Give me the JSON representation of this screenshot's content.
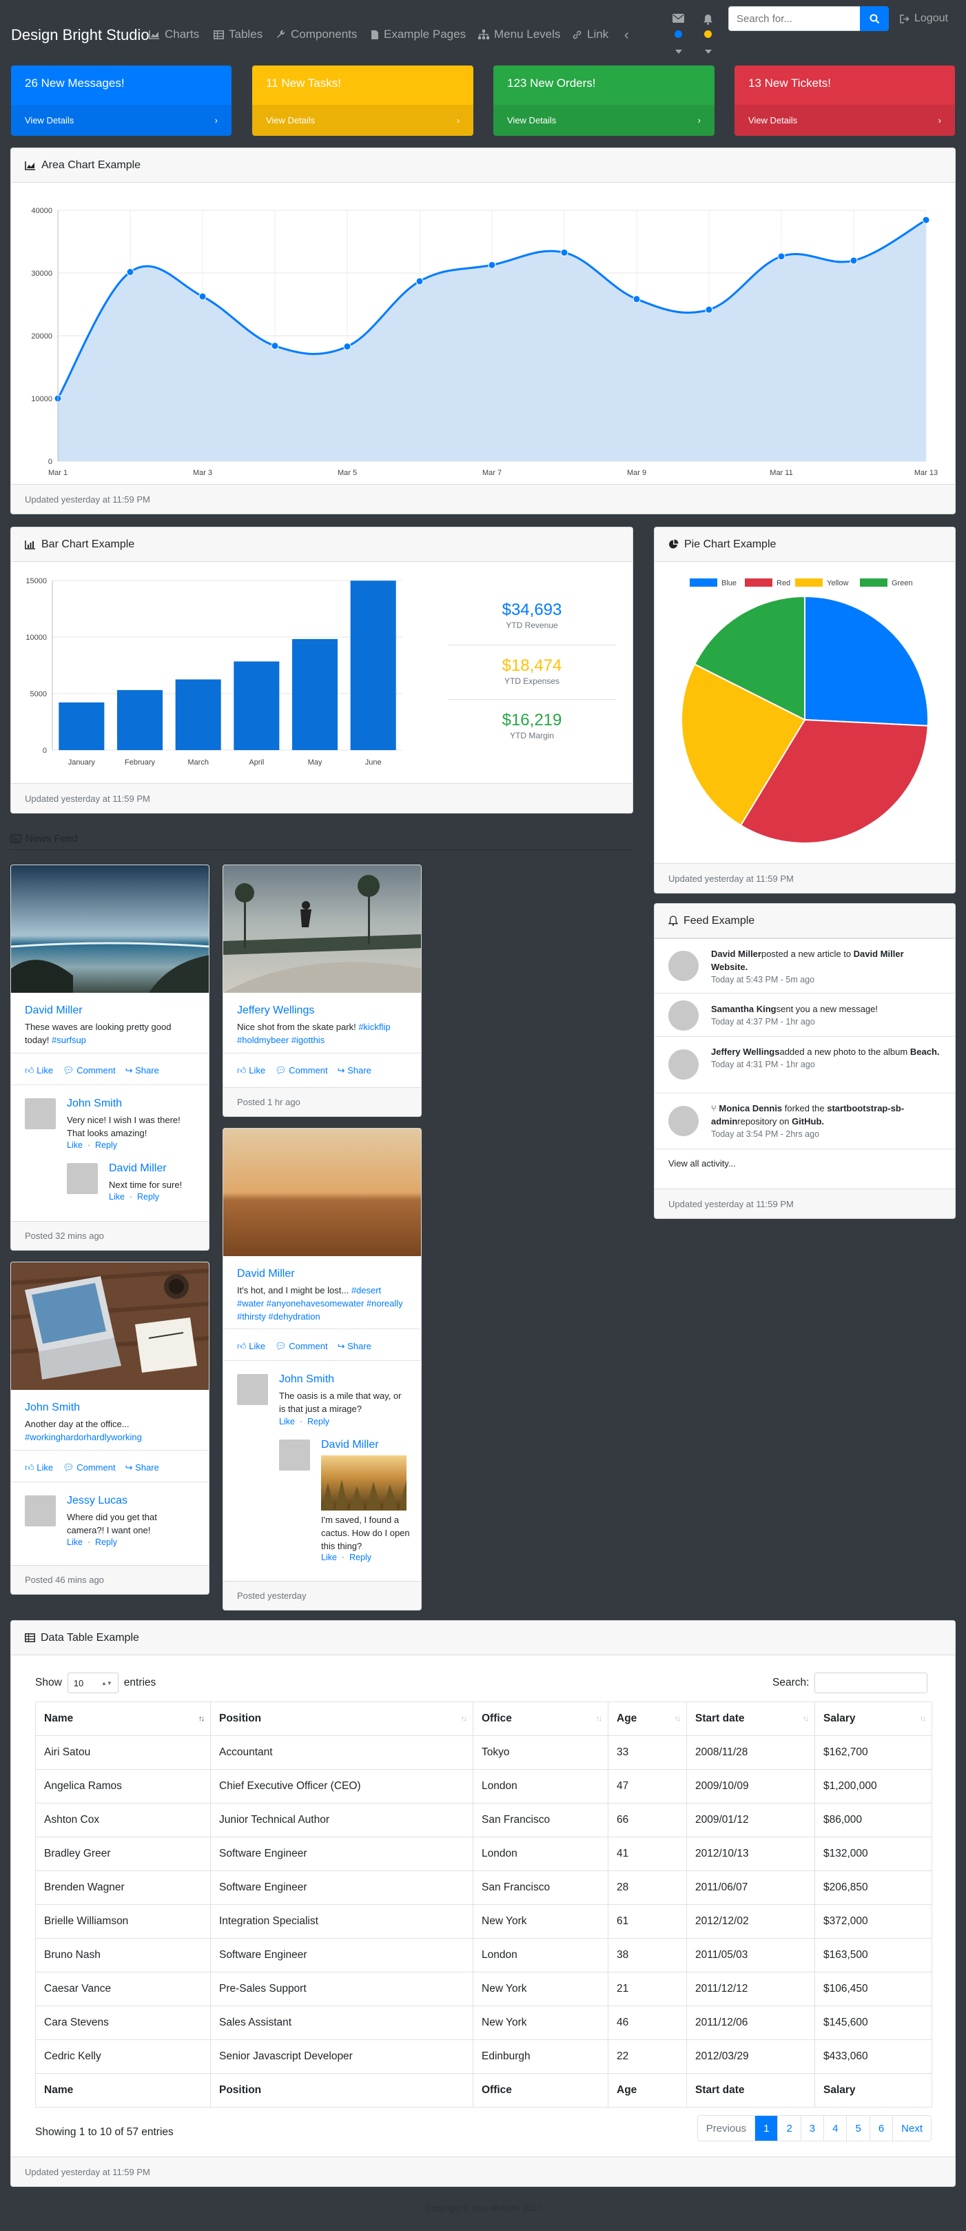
{
  "navbar": {
    "brand": "Design Bright Studio",
    "items": [
      {
        "label": "Charts",
        "icon": "area-chart-icon"
      },
      {
        "label": "Tables",
        "icon": "table-icon"
      },
      {
        "label": "Components",
        "icon": "wrench-icon"
      },
      {
        "label": "Example Pages",
        "icon": "file-icon"
      },
      {
        "label": "Menu Levels",
        "icon": "sitemap-icon"
      },
      {
        "label": "Link",
        "icon": "link-icon"
      }
    ],
    "search_placeholder": "Search for...",
    "logout": "Logout",
    "message_dot_color": "#007bff",
    "alert_dot_color": "#ffc107"
  },
  "stat_cards": [
    {
      "title": "26 New Messages!",
      "link": "View Details",
      "color": "#007bff"
    },
    {
      "title": "11 New Tasks!",
      "link": "View Details",
      "color": "#ffc107"
    },
    {
      "title": "123 New Orders!",
      "link": "View Details",
      "color": "#28a745"
    },
    {
      "title": "13 New Tickets!",
      "link": "View Details",
      "color": "#dc3545"
    }
  ],
  "area_card": {
    "title": "Area Chart Example",
    "footer": "Updated yesterday at 11:59 PM"
  },
  "bar_card": {
    "title": "Bar Chart Example",
    "footer": "Updated yesterday at 11:59 PM",
    "stats": [
      {
        "value": "$34,693",
        "label": "YTD Revenue",
        "color": "#007bff"
      },
      {
        "value": "$18,474",
        "label": "YTD Expenses",
        "color": "#ffc107"
      },
      {
        "value": "$16,219",
        "label": "YTD Margin",
        "color": "#28a745"
      }
    ]
  },
  "pie_card": {
    "title": "Pie Chart Example",
    "footer": "Updated yesterday at 11:59 PM"
  },
  "chart_data": [
    {
      "type": "area",
      "x": [
        "Mar 1",
        "Mar 2",
        "Mar 3",
        "Mar 4",
        "Mar 5",
        "Mar 6",
        "Mar 7",
        "Mar 8",
        "Mar 9",
        "Mar 10",
        "Mar 11",
        "Mar 12",
        "Mar 13"
      ],
      "x_tick_labels": [
        "Mar 1",
        "Mar 3",
        "Mar 5",
        "Mar 7",
        "Mar 9",
        "Mar 11",
        "Mar 13"
      ],
      "values": [
        10000,
        30162,
        26263,
        18394,
        18287,
        28682,
        31274,
        33259,
        25849,
        24159,
        32651,
        31984,
        38451
      ],
      "ylim": [
        0,
        40000
      ],
      "y_ticks": [
        0,
        10000,
        20000,
        30000,
        40000
      ],
      "line_color": "#007bff",
      "fill_color": "#cfe2f6",
      "grid": true
    },
    {
      "type": "bar",
      "categories": [
        "January",
        "February",
        "March",
        "April",
        "May",
        "June"
      ],
      "values": [
        4215,
        5312,
        6251,
        7841,
        9821,
        14984
      ],
      "ylim": [
        0,
        15000
      ],
      "y_ticks": [
        0,
        5000,
        10000,
        15000
      ],
      "color": "#0a6fd6",
      "grid": true
    },
    {
      "type": "pie",
      "legend_position": "top",
      "series": [
        {
          "name": "Blue",
          "value": 12.21,
          "color": "#007bff"
        },
        {
          "name": "Red",
          "value": 15.58,
          "color": "#dc3545"
        },
        {
          "name": "Yellow",
          "value": 11.25,
          "color": "#ffc107"
        },
        {
          "name": "Green",
          "value": 8.32,
          "color": "#28a745"
        }
      ]
    }
  ],
  "news": {
    "header": "News Feed",
    "like": "Like",
    "comment": "Comment",
    "share": "Share",
    "reply": "Reply",
    "dot": "·",
    "posts": [
      {
        "author": "David Miller",
        "text": "These waves are looking pretty good today!",
        "tags": "#surfsup",
        "footer": "Posted 32 mins ago",
        "comments": [
          {
            "name": "John Smith",
            "text": "Very nice! I wish I was there! That looks amazing!"
          },
          {
            "name": "David Miller",
            "text": "Next time for sure!"
          }
        ]
      },
      {
        "author": "Jeffery Wellings",
        "text": "Nice shot from the skate park!",
        "tags": "#kickflip #holdmybeer #igotthis",
        "footer": "Posted 1 hr ago",
        "comments": []
      },
      {
        "author": "David Miller",
        "text": "It's hot, and I might be lost...",
        "tags": "#desert #water #anyonehavesomewater #noreally #thirsty #dehydration",
        "footer": "Posted yesterday",
        "comments": [
          {
            "name": "John Smith",
            "text": "The oasis is a mile that way, or is that just a mirage?"
          },
          {
            "name": "David Miller",
            "text": "I'm saved, I found a cactus. How do I open this thing?"
          }
        ]
      },
      {
        "author": "John Smith",
        "text": "Another day at the office...",
        "tags": "#workinghardorhardlyworking",
        "footer": "Posted 46 mins ago",
        "comments": [
          {
            "name": "Jessy Lucas",
            "text": "Where did you get that camera?! I want one!"
          }
        ]
      }
    ]
  },
  "feed": {
    "title": "Feed Example",
    "items": [
      {
        "strong": "David Miller",
        "text": "posted a new article to",
        "strong2": "David Miller Website.",
        "time": "Today at 5:43 PM - 5m ago"
      },
      {
        "strong": "Samantha King",
        "text": "sent you a new message!",
        "strong2": "",
        "time": "Today at 4:37 PM - 1hr ago"
      },
      {
        "strong": "Jeffery Wellings",
        "text": "added a new photo to the album",
        "strong2": "Beach.",
        "time": "Today at 4:31 PM - 1hr ago"
      },
      {
        "strong": "Monica Dennis",
        "text": "forked the",
        "strong2": "startbootstrap-sb-admin",
        "text2": "repository on",
        "strong3": "GitHub.",
        "time": "Today at 3:54 PM - 2hrs ago"
      }
    ],
    "view_all": "View all activity...",
    "footer": "Updated yesterday at 11:59 PM"
  },
  "datatable": {
    "title": "Data Table Example",
    "show": "Show",
    "entries": "entries",
    "length_value": "10",
    "search_label": "Search:",
    "columns": [
      "Name",
      "Position",
      "Office",
      "Age",
      "Start date",
      "Salary"
    ],
    "rows": [
      [
        "Airi Satou",
        "Accountant",
        "Tokyo",
        "33",
        "2008/11/28",
        "$162,700"
      ],
      [
        "Angelica Ramos",
        "Chief Executive Officer (CEO)",
        "London",
        "47",
        "2009/10/09",
        "$1,200,000"
      ],
      [
        "Ashton Cox",
        "Junior Technical Author",
        "San Francisco",
        "66",
        "2009/01/12",
        "$86,000"
      ],
      [
        "Bradley Greer",
        "Software Engineer",
        "London",
        "41",
        "2012/10/13",
        "$132,000"
      ],
      [
        "Brenden Wagner",
        "Software Engineer",
        "San Francisco",
        "28",
        "2011/06/07",
        "$206,850"
      ],
      [
        "Brielle Williamson",
        "Integration Specialist",
        "New York",
        "61",
        "2012/12/02",
        "$372,000"
      ],
      [
        "Bruno Nash",
        "Software Engineer",
        "London",
        "38",
        "2011/05/03",
        "$163,500"
      ],
      [
        "Caesar Vance",
        "Pre-Sales Support",
        "New York",
        "21",
        "2011/12/12",
        "$106,450"
      ],
      [
        "Cara Stevens",
        "Sales Assistant",
        "New York",
        "46",
        "2011/12/06",
        "$145,600"
      ],
      [
        "Cedric Kelly",
        "Senior Javascript Developer",
        "Edinburgh",
        "22",
        "2012/03/29",
        "$433,060"
      ]
    ],
    "info": "Showing 1 to 10 of 57 entries",
    "pagination": [
      "Previous",
      "1",
      "2",
      "3",
      "4",
      "5",
      "6",
      "Next"
    ],
    "active_page": "1",
    "footer": "Updated yesterday at 11:59 PM"
  },
  "copyright": "Copyright © Your Website 2017"
}
